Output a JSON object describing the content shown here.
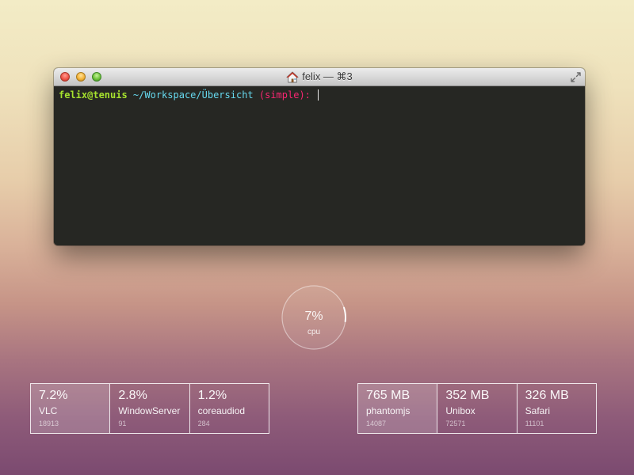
{
  "terminal": {
    "title": "felix — ⌘3",
    "prompt_user": "felix@tenuis",
    "prompt_path": " ~/Workspace/Übersicht",
    "prompt_branch": " (simple):",
    "prompt_suffix": " "
  },
  "cpu_widget": {
    "value": "7%",
    "label": "cpu",
    "fraction": 0.07
  },
  "cpu_processes": [
    {
      "value": "7.2%",
      "name": "VLC",
      "pid": "18913"
    },
    {
      "value": "2.8%",
      "name": "WindowServer",
      "pid": "91"
    },
    {
      "value": "1.2%",
      "name": "coreaudiod",
      "pid": "284"
    }
  ],
  "memory_processes": [
    {
      "value": "765 MB",
      "name": "phantomjs",
      "pid": "14087"
    },
    {
      "value": "352 MB",
      "name": "Unibox",
      "pid": "72571"
    },
    {
      "value": "326 MB",
      "name": "Safari",
      "pid": "11101"
    }
  ],
  "colors": {
    "prompt_user": "#a6e22e",
    "prompt_path": "#66d9ef",
    "prompt_branch": "#f92672",
    "terminal_bg": "#262723"
  },
  "icons": {
    "title": "home-icon",
    "fullscreen": "fullscreen-icon"
  }
}
